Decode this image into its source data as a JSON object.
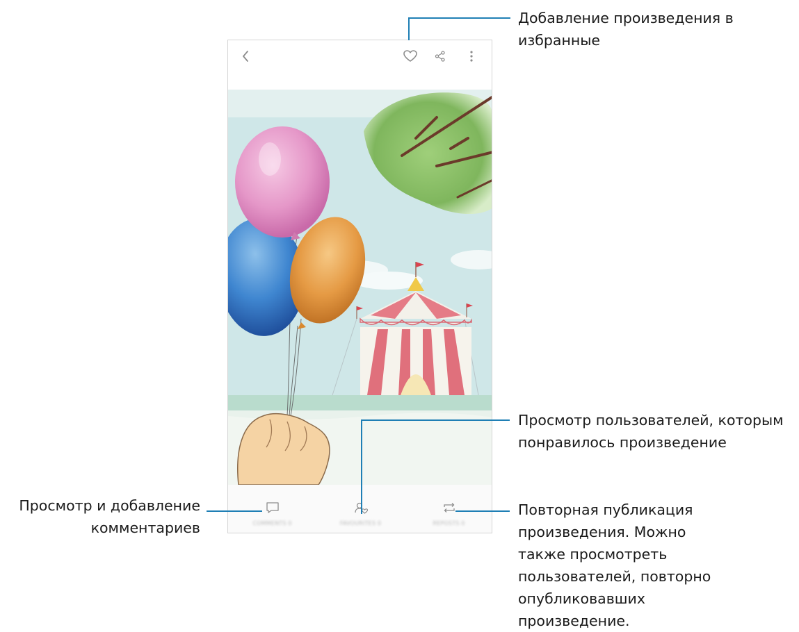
{
  "callouts": {
    "favorite": "Добавление произведения в избранные",
    "liked_users": "Просмотр пользователей, которым понравилось произведение",
    "comments": "Просмотр и добавление комментариев",
    "repost": "Повторная публикация произведения. Можно также просмотреть пользователей, повторно опубликовавших произведение."
  },
  "app_bar": {
    "icons": [
      "back-arrow-icon",
      "heart-icon",
      "share-icon",
      "more-vertical-icon"
    ]
  },
  "bottom_bar": {
    "comments_label": "COMMENTS 0",
    "likes_label": "FAVOURITES 0",
    "reposts_label": "REPOSTS 0"
  },
  "colors": {
    "callout_line": "#1f7fb5",
    "sky": "#cfe7e8",
    "icon_gray": "#8c8c8c"
  }
}
